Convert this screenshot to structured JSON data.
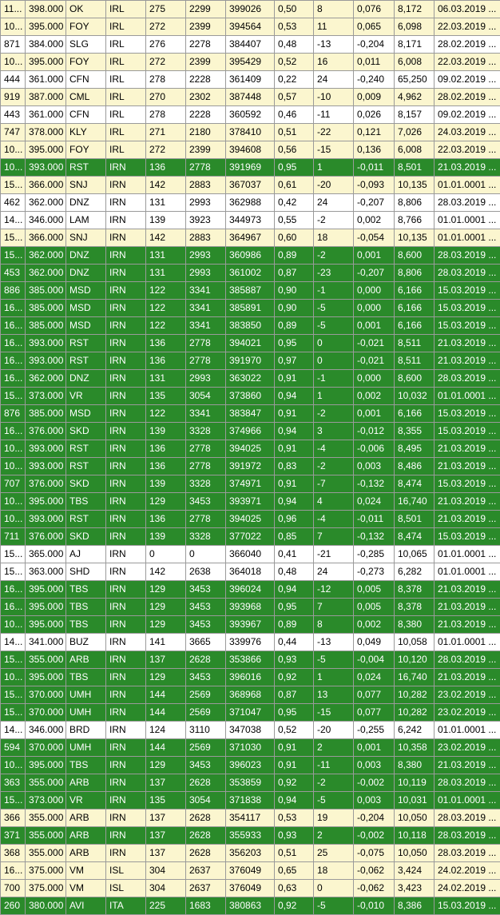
{
  "table": {
    "rows": [
      {
        "c": "y",
        "v": [
          "11...",
          "398.000",
          "OK",
          "IRL",
          "275",
          "2299",
          "399026",
          "0,50",
          "8",
          "0,076",
          "8,172",
          "06.03.2019 ..."
        ]
      },
      {
        "c": "y",
        "v": [
          "10...",
          "395.000",
          "FOY",
          "IRL",
          "272",
          "2399",
          "394564",
          "0,53",
          "11",
          "0,065",
          "6,098",
          "22.03.2019 ..."
        ]
      },
      {
        "c": "w",
        "v": [
          "871",
          "384.000",
          "SLG",
          "IRL",
          "276",
          "2278",
          "384407",
          "0,48",
          "-13",
          "-0,204",
          "8,171",
          "28.02.2019 ..."
        ]
      },
      {
        "c": "y",
        "v": [
          "10...",
          "395.000",
          "FOY",
          "IRL",
          "272",
          "2399",
          "395429",
          "0,52",
          "16",
          "0,011",
          "6,008",
          "22.03.2019 ..."
        ]
      },
      {
        "c": "w",
        "v": [
          "444",
          "361.000",
          "CFN",
          "IRL",
          "278",
          "2228",
          "361409",
          "0,22",
          "24",
          "-0,240",
          "65,250",
          "09.02.2019 ..."
        ]
      },
      {
        "c": "y",
        "v": [
          "919",
          "387.000",
          "CML",
          "IRL",
          "270",
          "2302",
          "387448",
          "0,57",
          "-10",
          "0,009",
          "4,962",
          "28.02.2019 ..."
        ]
      },
      {
        "c": "w",
        "v": [
          "443",
          "361.000",
          "CFN",
          "IRL",
          "278",
          "2228",
          "360592",
          "0,46",
          "-11",
          "0,026",
          "8,157",
          "09.02.2019 ..."
        ]
      },
      {
        "c": "y",
        "v": [
          "747",
          "378.000",
          "KLY",
          "IRL",
          "271",
          "2180",
          "378410",
          "0,51",
          "-22",
          "0,121",
          "7,026",
          "24.03.2019 ..."
        ]
      },
      {
        "c": "y",
        "v": [
          "10...",
          "395.000",
          "FOY",
          "IRL",
          "272",
          "2399",
          "394608",
          "0,56",
          "-15",
          "0,136",
          "6,008",
          "22.03.2019 ..."
        ]
      },
      {
        "c": "g",
        "v": [
          "10...",
          "393.000",
          "RST",
          "IRN",
          "136",
          "2778",
          "391969",
          "0,95",
          "1",
          "-0,011",
          "8,501",
          "21.03.2019 ..."
        ]
      },
      {
        "c": "y",
        "v": [
          "15...",
          "366.000",
          "SNJ",
          "IRN",
          "142",
          "2883",
          "367037",
          "0,61",
          "-20",
          "-0,093",
          "10,135",
          "01.01.0001 ..."
        ]
      },
      {
        "c": "w",
        "v": [
          "462",
          "362.000",
          "DNZ",
          "IRN",
          "131",
          "2993",
          "362988",
          "0,42",
          "24",
          "-0,207",
          "8,806",
          "28.03.2019 ..."
        ]
      },
      {
        "c": "w",
        "v": [
          "14...",
          "346.000",
          "LAM",
          "IRN",
          "139",
          "3923",
          "344973",
          "0,55",
          "-2",
          "0,002",
          "8,766",
          "01.01.0001 ..."
        ]
      },
      {
        "c": "y",
        "v": [
          "15...",
          "366.000",
          "SNJ",
          "IRN",
          "142",
          "2883",
          "364967",
          "0,60",
          "18",
          "-0,054",
          "10,135",
          "01.01.0001 ..."
        ]
      },
      {
        "c": "g",
        "v": [
          "15...",
          "362.000",
          "DNZ",
          "IRN",
          "131",
          "2993",
          "360986",
          "0,89",
          "-2",
          "0,001",
          "8,600",
          "28.03.2019 ..."
        ]
      },
      {
        "c": "g",
        "v": [
          "453",
          "362.000",
          "DNZ",
          "IRN",
          "131",
          "2993",
          "361002",
          "0,87",
          "-23",
          "-0,207",
          "8,806",
          "28.03.2019 ..."
        ]
      },
      {
        "c": "g",
        "v": [
          "886",
          "385.000",
          "MSD",
          "IRN",
          "122",
          "3341",
          "385887",
          "0,90",
          "-1",
          "0,000",
          "6,166",
          "15.03.2019 ..."
        ]
      },
      {
        "c": "g",
        "v": [
          "16...",
          "385.000",
          "MSD",
          "IRN",
          "122",
          "3341",
          "385891",
          "0,90",
          "-5",
          "0,000",
          "6,166",
          "15.03.2019 ..."
        ]
      },
      {
        "c": "g",
        "v": [
          "16...",
          "385.000",
          "MSD",
          "IRN",
          "122",
          "3341",
          "383850",
          "0,89",
          "-5",
          "0,001",
          "6,166",
          "15.03.2019 ..."
        ]
      },
      {
        "c": "g",
        "v": [
          "16...",
          "393.000",
          "RST",
          "IRN",
          "136",
          "2778",
          "394021",
          "0,95",
          "0",
          "-0,021",
          "8,511",
          "21.03.2019 ..."
        ]
      },
      {
        "c": "g",
        "v": [
          "16...",
          "393.000",
          "RST",
          "IRN",
          "136",
          "2778",
          "391970",
          "0,97",
          "0",
          "-0,021",
          "8,511",
          "21.03.2019 ..."
        ]
      },
      {
        "c": "g",
        "v": [
          "16...",
          "362.000",
          "DNZ",
          "IRN",
          "131",
          "2993",
          "363022",
          "0,91",
          "-1",
          "0,000",
          "8,600",
          "28.03.2019 ..."
        ]
      },
      {
        "c": "g",
        "v": [
          "15...",
          "373.000",
          "VR",
          "IRN",
          "135",
          "3054",
          "373860",
          "0,94",
          "1",
          "0,002",
          "10,032",
          "01.01.0001 ..."
        ]
      },
      {
        "c": "g",
        "v": [
          "876",
          "385.000",
          "MSD",
          "IRN",
          "122",
          "3341",
          "383847",
          "0,91",
          "-2",
          "0,001",
          "6,166",
          "15.03.2019 ..."
        ]
      },
      {
        "c": "g",
        "v": [
          "16...",
          "376.000",
          "SKD",
          "IRN",
          "139",
          "3328",
          "374966",
          "0,94",
          "3",
          "-0,012",
          "8,355",
          "15.03.2019 ..."
        ]
      },
      {
        "c": "g",
        "v": [
          "10...",
          "393.000",
          "RST",
          "IRN",
          "136",
          "2778",
          "394025",
          "0,91",
          "-4",
          "-0,006",
          "8,495",
          "21.03.2019 ..."
        ]
      },
      {
        "c": "g",
        "v": [
          "10...",
          "393.000",
          "RST",
          "IRN",
          "136",
          "2778",
          "391972",
          "0,83",
          "-2",
          "0,003",
          "8,486",
          "21.03.2019 ..."
        ]
      },
      {
        "c": "g",
        "v": [
          "707",
          "376.000",
          "SKD",
          "IRN",
          "139",
          "3328",
          "374971",
          "0,91",
          "-7",
          "-0,132",
          "8,474",
          "15.03.2019 ..."
        ]
      },
      {
        "c": "g",
        "v": [
          "10...",
          "395.000",
          "TBS",
          "IRN",
          "129",
          "3453",
          "393971",
          "0,94",
          "4",
          "0,024",
          "16,740",
          "21.03.2019 ..."
        ]
      },
      {
        "c": "g",
        "v": [
          "10...",
          "393.000",
          "RST",
          "IRN",
          "136",
          "2778",
          "394025",
          "0,96",
          "-4",
          "-0,011",
          "8,501",
          "21.03.2019 ..."
        ]
      },
      {
        "c": "g",
        "v": [
          "711",
          "376.000",
          "SKD",
          "IRN",
          "139",
          "3328",
          "377022",
          "0,85",
          "7",
          "-0,132",
          "8,474",
          "15.03.2019 ..."
        ]
      },
      {
        "c": "w",
        "v": [
          "15...",
          "365.000",
          "AJ",
          "IRN",
          "0",
          "0",
          "366040",
          "0,41",
          "-21",
          "-0,285",
          "10,065",
          "01.01.0001 ..."
        ]
      },
      {
        "c": "w",
        "v": [
          "15...",
          "363.000",
          "SHD",
          "IRN",
          "142",
          "2638",
          "364018",
          "0,48",
          "24",
          "-0,273",
          "6,282",
          "01.01.0001 ..."
        ]
      },
      {
        "c": "g",
        "v": [
          "16...",
          "395.000",
          "TBS",
          "IRN",
          "129",
          "3453",
          "396024",
          "0,94",
          "-12",
          "0,005",
          "8,378",
          "21.03.2019 ..."
        ]
      },
      {
        "c": "g",
        "v": [
          "16...",
          "395.000",
          "TBS",
          "IRN",
          "129",
          "3453",
          "393968",
          "0,95",
          "7",
          "0,005",
          "8,378",
          "21.03.2019 ..."
        ]
      },
      {
        "c": "g",
        "v": [
          "10...",
          "395.000",
          "TBS",
          "IRN",
          "129",
          "3453",
          "393967",
          "0,89",
          "8",
          "0,002",
          "8,380",
          "21.03.2019 ..."
        ]
      },
      {
        "c": "w",
        "v": [
          "14...",
          "341.000",
          "BUZ",
          "IRN",
          "141",
          "3665",
          "339976",
          "0,44",
          "-13",
          "0,049",
          "10,058",
          "01.01.0001 ..."
        ]
      },
      {
        "c": "g",
        "v": [
          "15...",
          "355.000",
          "ARB",
          "IRN",
          "137",
          "2628",
          "353866",
          "0,93",
          "-5",
          "-0,004",
          "10,120",
          "28.03.2019 ..."
        ]
      },
      {
        "c": "g",
        "v": [
          "10...",
          "395.000",
          "TBS",
          "IRN",
          "129",
          "3453",
          "396016",
          "0,92",
          "1",
          "0,024",
          "16,740",
          "21.03.2019 ..."
        ]
      },
      {
        "c": "g",
        "v": [
          "15...",
          "370.000",
          "UMH",
          "IRN",
          "144",
          "2569",
          "368968",
          "0,87",
          "13",
          "0,077",
          "10,282",
          "23.02.2019 ..."
        ]
      },
      {
        "c": "g",
        "v": [
          "15...",
          "370.000",
          "UMH",
          "IRN",
          "144",
          "2569",
          "371047",
          "0,95",
          "-15",
          "0,077",
          "10,282",
          "23.02.2019 ..."
        ]
      },
      {
        "c": "w",
        "v": [
          "14...",
          "346.000",
          "BRD",
          "IRN",
          "124",
          "3110",
          "347038",
          "0,52",
          "-20",
          "-0,255",
          "6,242",
          "01.01.0001 ..."
        ]
      },
      {
        "c": "g",
        "v": [
          "594",
          "370.000",
          "UMH",
          "IRN",
          "144",
          "2569",
          "371030",
          "0,91",
          "2",
          "0,001",
          "10,358",
          "23.02.2019 ..."
        ]
      },
      {
        "c": "g",
        "v": [
          "10...",
          "395.000",
          "TBS",
          "IRN",
          "129",
          "3453",
          "396023",
          "0,91",
          "-11",
          "0,003",
          "8,380",
          "21.03.2019 ..."
        ]
      },
      {
        "c": "g",
        "v": [
          "363",
          "355.000",
          "ARB",
          "IRN",
          "137",
          "2628",
          "353859",
          "0,92",
          "-2",
          "-0,002",
          "10,119",
          "28.03.2019 ..."
        ]
      },
      {
        "c": "g",
        "v": [
          "15...",
          "373.000",
          "VR",
          "IRN",
          "135",
          "3054",
          "371838",
          "0,94",
          "-5",
          "0,003",
          "10,031",
          "01.01.0001 ..."
        ]
      },
      {
        "c": "y",
        "v": [
          "366",
          "355.000",
          "ARB",
          "IRN",
          "137",
          "2628",
          "354117",
          "0,53",
          "19",
          "-0,204",
          "10,050",
          "28.03.2019 ..."
        ]
      },
      {
        "c": "g",
        "v": [
          "371",
          "355.000",
          "ARB",
          "IRN",
          "137",
          "2628",
          "355933",
          "0,93",
          "2",
          "-0,002",
          "10,118",
          "28.03.2019 ..."
        ]
      },
      {
        "c": "y",
        "v": [
          "368",
          "355.000",
          "ARB",
          "IRN",
          "137",
          "2628",
          "356203",
          "0,51",
          "25",
          "-0,075",
          "10,050",
          "28.03.2019 ..."
        ]
      },
      {
        "c": "y",
        "v": [
          "16...",
          "375.000",
          "VM",
          "ISL",
          "304",
          "2637",
          "376049",
          "0,65",
          "18",
          "-0,062",
          "3,424",
          "24.02.2019 ..."
        ]
      },
      {
        "c": "y",
        "v": [
          "700",
          "375.000",
          "VM",
          "ISL",
          "304",
          "2637",
          "376049",
          "0,63",
          "0",
          "-0,062",
          "3,423",
          "24.02.2019 ..."
        ]
      },
      {
        "c": "g",
        "v": [
          "260",
          "380.000",
          "AVI",
          "ITA",
          "225",
          "1683",
          "380863",
          "0,92",
          "-5",
          "-0,010",
          "8,386",
          "15.03.2019 ..."
        ]
      }
    ]
  }
}
